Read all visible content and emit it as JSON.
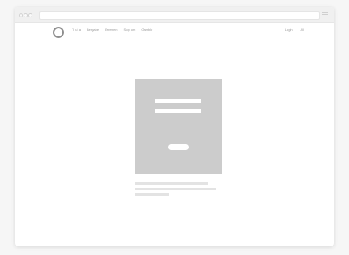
{
  "browser": {
    "url": "",
    "menu_icon": "hamburger-icon",
    "traffic_lights": [
      "close",
      "minimize",
      "maximize"
    ]
  },
  "navbar": {
    "logo_icon": "circle-logo-icon",
    "links": [
      "Ti ut a",
      "Bergabe",
      "Erremen",
      "Stop om",
      "Gamble"
    ],
    "right_links": [
      "Login",
      "All"
    ]
  },
  "login_card": {
    "fields": [
      "",
      ""
    ],
    "submit_label": ""
  },
  "colors": {
    "card_background": "#cccccc",
    "page_background": "#f6f6f6",
    "placeholder_lines": "#e3e3e3"
  }
}
